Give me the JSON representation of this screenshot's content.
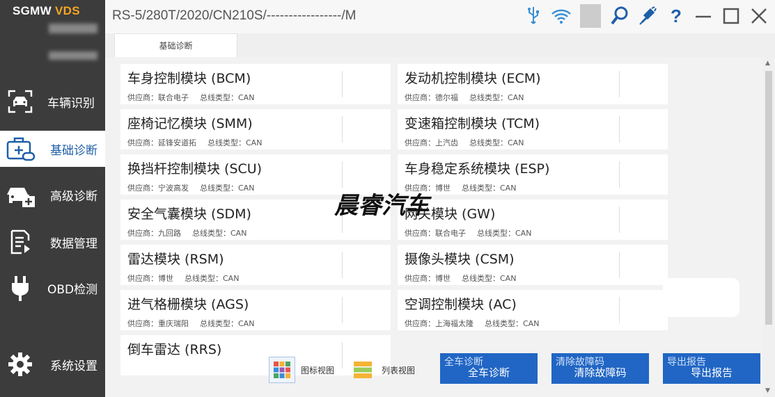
{
  "app": {
    "logo_main": "SGMW",
    "logo_accent": "VDS",
    "vehicle_path": "RS-5/280T/2020/CN210S/-----------------/M"
  },
  "sidebar": {
    "items": [
      {
        "label": "车辆识别"
      },
      {
        "label": "基础诊断"
      },
      {
        "label": "高级诊断"
      },
      {
        "label": "数据管理"
      },
      {
        "label": "OBD检测"
      },
      {
        "label": "系统设置"
      }
    ]
  },
  "tabs": [
    {
      "label": "基础诊断"
    }
  ],
  "modules": [
    {
      "name": "车身控制模块 (BCM)",
      "supplier": "供应商：联合电子",
      "bus": "总线类型：CAN"
    },
    {
      "name": "发动机控制模块 (ECM)",
      "supplier": "供应商：德尔福",
      "bus": "总线类型：CAN"
    },
    {
      "name": "座椅记忆模块 (SMM)",
      "supplier": "供应商：延锋安道拓",
      "bus": "总线类型：CAN"
    },
    {
      "name": "变速箱控制模块 (TCM)",
      "supplier": "供应商：上汽齿",
      "bus": "总线类型：CAN"
    },
    {
      "name": "换挡杆控制模块 (SCU)",
      "supplier": "供应商：宁波高发",
      "bus": "总线类型：CAN"
    },
    {
      "name": "车身稳定系统模块 (ESP)",
      "supplier": "供应商：博世",
      "bus": "总线类型：CAN"
    },
    {
      "name": "安全气囊模块 (SDM)",
      "supplier": "供应商：九回路",
      "bus": "总线类型：CAN"
    },
    {
      "name": "网关模块 (GW)",
      "supplier": "供应商：联合电子",
      "bus": "总线类型：CAN"
    },
    {
      "name": "雷达模块 (RSM)",
      "supplier": "供应商：博世",
      "bus": "总线类型：CAN"
    },
    {
      "name": "摄像头模块 (CSM)",
      "supplier": "供应商：博世",
      "bus": "总线类型：CAN"
    },
    {
      "name": "进气格栅模块 (AGS)",
      "supplier": "供应商：重庆瑞阳",
      "bus": "总线类型：CAN"
    },
    {
      "name": "空调控制模块 (AC)",
      "supplier": "供应商：上海福太隆",
      "bus": "总线类型：CAN"
    },
    {
      "name": "倒车雷达 (RRS)",
      "supplier": "",
      "bus": ""
    }
  ],
  "watermark": "晨睿汽车",
  "bottom": {
    "icon_view": "图标视图",
    "list_view": "列表视图",
    "full_scan": "全车诊断",
    "full_scan_ghost": "全车诊断",
    "clear_dtc": "清除故障码",
    "clear_dtc_ghost": "清除故障码",
    "export_report": "导出报告",
    "export_report_ghost": "导出报告"
  },
  "colors": {
    "sidebar_bg": "#3c3c3c",
    "accent_blue": "#2166c4",
    "logo_accent": "#f5a623"
  }
}
